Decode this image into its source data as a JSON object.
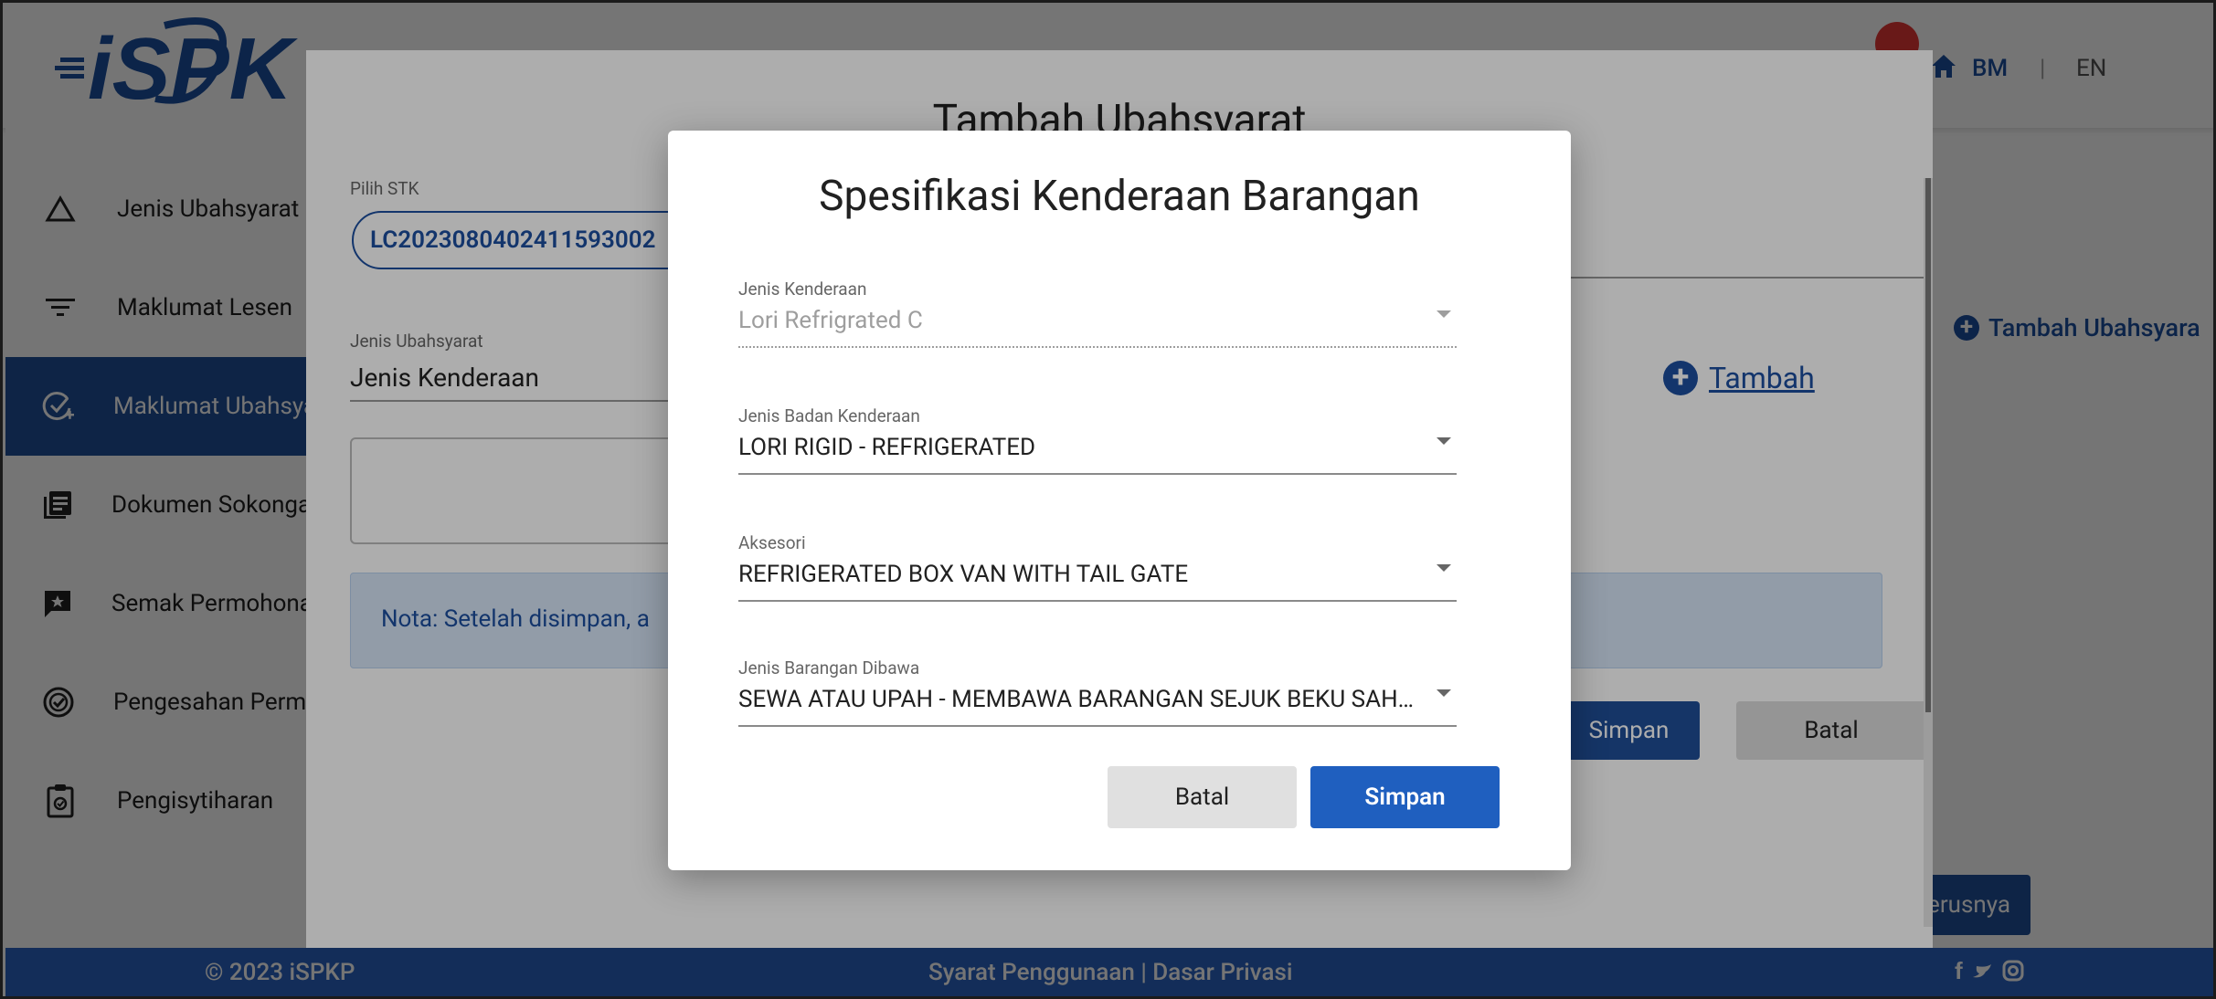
{
  "header": {
    "logo_text": "iSPKP",
    "lang_bm": "BM",
    "lang_sep": "|",
    "lang_en": "EN"
  },
  "sidebar": {
    "items": [
      {
        "label": "Jenis Ubahsyarat",
        "icon": "triangle-icon"
      },
      {
        "label": "Maklumat Lesen",
        "icon": "filter-icon"
      },
      {
        "label": "Maklumat Ubahsyarat",
        "icon": "check-circle-plus-icon",
        "active": true
      },
      {
        "label": "Dokumen Sokongan",
        "icon": "documents-icon"
      },
      {
        "label": "Semak Permohonan",
        "icon": "review-icon"
      },
      {
        "label": "Pengesahan Permohonan",
        "icon": "verified-icon"
      },
      {
        "label": "Pengisytiharan",
        "icon": "clipboard-icon"
      }
    ]
  },
  "main": {
    "tambah_ubahsyarat": "Tambah Ubahsyara",
    "next_button": "erusnya"
  },
  "dialog_tambah": {
    "title": "Tambah Ubahsyarat",
    "pilih_stk_label": "Pilih STK",
    "pilih_stk_value": "LC2023080402411593002",
    "jenis_ubahsyarat_label": "Jenis Ubahsyarat",
    "jenis_ubahsyarat_value": "Jenis Kenderaan",
    "tambah_link": "Tambah",
    "nota": "Nota: Setelah disimpan, a",
    "simpan_label": "Simpan",
    "batal_label": "Batal"
  },
  "dialog_spesifikasi": {
    "title": "Spesifikasi Kenderaan Barangan",
    "fields": [
      {
        "label": "Jenis Kenderaan",
        "value": "Lori Refrigrated C",
        "disabled": true
      },
      {
        "label": "Jenis Badan Kenderaan",
        "value": "LORI RIGID - REFRIGERATED"
      },
      {
        "label": "Aksesori",
        "value": "REFRIGERATED BOX VAN WITH TAIL GATE"
      },
      {
        "label": "Jenis Barangan Dibawa",
        "value": "SEWA ATAU UPAH - MEMBAWA BARANGAN SEJUK BEKU SAH…"
      }
    ],
    "batal_label": "Batal",
    "simpan_label": "Simpan"
  },
  "footer": {
    "copyright": "© 2023 iSPKP",
    "links": "Syarat Penggunaan | Dasar Privasi",
    "social": "f 🐦 ◎"
  },
  "colors": {
    "primary": "#1f4f98",
    "footer": "#2b64c1",
    "accent": "#1d4fa0"
  }
}
